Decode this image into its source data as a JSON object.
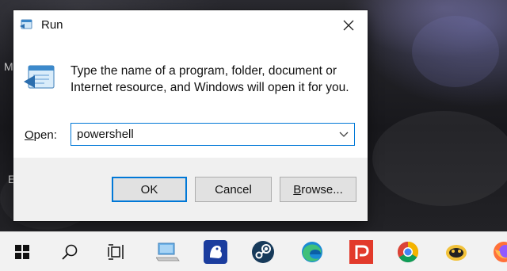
{
  "desktop": {
    "edge_chars": [
      "M",
      "E"
    ]
  },
  "dialog": {
    "title": "Run",
    "description": "Type the name of a program, folder, document or Internet resource, and Windows will open it for you.",
    "open_label_underlined": "O",
    "open_label_rest": "pen:",
    "open_value": "powershell",
    "buttons": {
      "ok": "OK",
      "cancel": "Cancel",
      "browse_underlined": "B",
      "browse_rest": "rowse..."
    },
    "accent_color": "#0078d7"
  },
  "taskbar": {
    "items": [
      {
        "icon": "windows-start-icon"
      },
      {
        "icon": "search-icon"
      },
      {
        "icon": "task-view-icon"
      },
      {
        "icon": "this-pc-icon"
      },
      {
        "icon": "app-frog-icon"
      },
      {
        "icon": "steam-icon"
      },
      {
        "icon": "edge-icon"
      },
      {
        "icon": "pocketcasts-icon"
      },
      {
        "icon": "chrome-icon"
      },
      {
        "icon": "duck-app-icon"
      },
      {
        "icon": "firefox-icon"
      }
    ]
  }
}
